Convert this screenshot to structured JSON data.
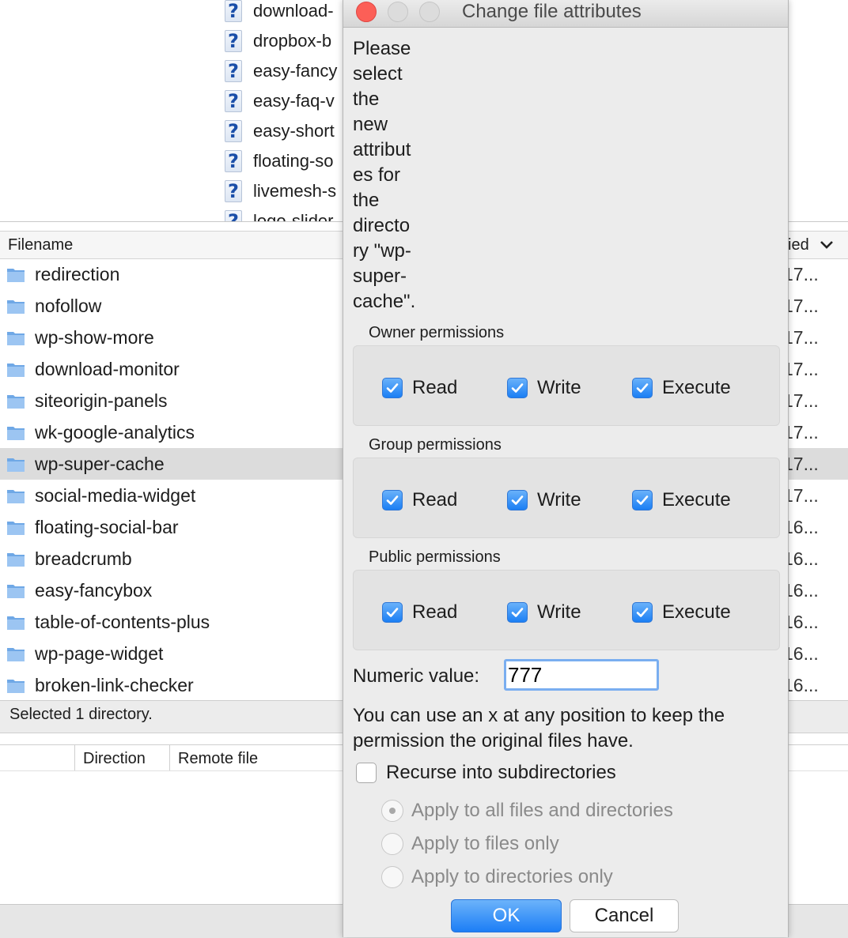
{
  "remote_tree": {
    "items": [
      "download-",
      "dropbox-b",
      "easy-fancy",
      "easy-faq-v",
      "easy-short",
      "floating-so",
      "livemesh-s",
      "logo-slider"
    ]
  },
  "file_list": {
    "header_filename": "Filename",
    "header_modified": "ied",
    "rows": [
      {
        "name": "redirection",
        "date": "17..."
      },
      {
        "name": "nofollow",
        "date": "17..."
      },
      {
        "name": "wp-show-more",
        "date": "17..."
      },
      {
        "name": "download-monitor",
        "date": "17..."
      },
      {
        "name": "siteorigin-panels",
        "date": "17..."
      },
      {
        "name": "wk-google-analytics",
        "date": "17..."
      },
      {
        "name": "wp-super-cache",
        "date": "17...",
        "selected": true
      },
      {
        "name": "social-media-widget",
        "date": "17..."
      },
      {
        "name": "floating-social-bar",
        "date": "16..."
      },
      {
        "name": "breadcrumb",
        "date": "16..."
      },
      {
        "name": "easy-fancybox",
        "date": "16..."
      },
      {
        "name": "table-of-contents-plus",
        "date": "16..."
      },
      {
        "name": "wp-page-widget",
        "date": "16..."
      },
      {
        "name": "broken-link-checker",
        "date": "16..."
      }
    ],
    "status": "Selected 1 directory."
  },
  "queue": {
    "col_direction": "Direction",
    "col_remote": "Remote file"
  },
  "dialog": {
    "title": "Change file attributes",
    "prompt": "Please select the new attribut es for the directo ry \"wp-super-cache\".",
    "prompt_lines": [
      "Please",
      "select",
      "the",
      "new",
      "attribut",
      "es for",
      "the",
      "directo",
      "ry \"wp-",
      "super-",
      "cache\"."
    ],
    "groups": [
      {
        "label": "Owner permissions",
        "read": "Read",
        "write": "Write",
        "execute": "Execute",
        "read_checked": true,
        "write_checked": true,
        "execute_checked": true
      },
      {
        "label": "Group permissions",
        "read": "Read",
        "write": "Write",
        "execute": "Execute",
        "read_checked": true,
        "write_checked": true,
        "execute_checked": true
      },
      {
        "label": "Public permissions",
        "read": "Read",
        "write": "Write",
        "execute": "Execute",
        "read_checked": true,
        "write_checked": true,
        "execute_checked": true
      }
    ],
    "numeric_label": "Numeric value:",
    "numeric_value": "777",
    "hint": "You can use an x at any position to keep the permission the original files have.",
    "recurse_label": "Recurse into subdirectories",
    "recurse_checked": false,
    "radio_options": [
      {
        "label": "Apply to all files and directories",
        "selected": true
      },
      {
        "label": "Apply to files only",
        "selected": false
      },
      {
        "label": "Apply to directories only",
        "selected": false
      }
    ],
    "ok_label": "OK",
    "cancel_label": "Cancel"
  },
  "colors": {
    "accent": "#1b7ff4",
    "close_button": "#fc5f57",
    "selection_row": "#dcdcdc"
  }
}
